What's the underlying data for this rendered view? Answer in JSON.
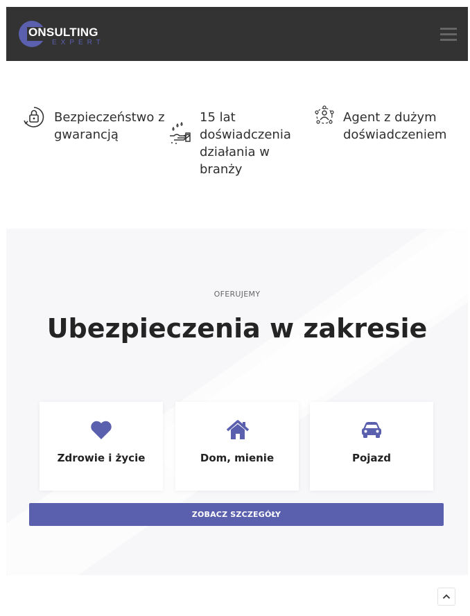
{
  "header": {
    "logo_main": "ONSULTING",
    "logo_sub": "EXPERT",
    "menu_icon": "hamburger-menu-icon"
  },
  "features": [
    {
      "icon": "lock-shield-icon",
      "text": "Bezpieczeństwo z gwarancją"
    },
    {
      "icon": "hand-water-icon",
      "text": "15 lat doświadczenia działania w branży"
    },
    {
      "icon": "agent-network-icon",
      "text": "Agent z dużym doświadczeniem"
    }
  ],
  "offer": {
    "kicker": "OFERUJEMY",
    "title": "Ubezpieczenia w zakresie",
    "cards": [
      {
        "icon": "heart-icon",
        "label": "Zdrowie i życie"
      },
      {
        "icon": "house-icon",
        "label": "Dom, mienie"
      },
      {
        "icon": "car-icon",
        "label": "Pojazd"
      }
    ],
    "cta_label": "ZOBACZ SZCZEGÓŁY"
  },
  "colors": {
    "header_bg": "#333333",
    "accent": "#5a5fae",
    "section_bg": "#f7f7f9"
  },
  "scroll_top_icon": "chevron-up-icon"
}
